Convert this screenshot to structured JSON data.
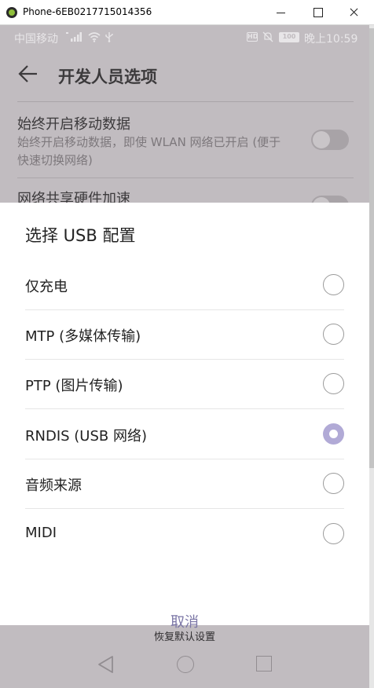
{
  "window": {
    "title": "Phone-6EB0217715014356"
  },
  "statusbar": {
    "carrier": "中国移动",
    "hd_badge": "HD",
    "battery": "100",
    "time": "晚上10:59"
  },
  "appbar": {
    "title": "开发人员选项"
  },
  "settings": [
    {
      "title": "始终开启移动数据",
      "subtitle": "始终开启移动数据，即使 WLAN 网络已开启 (便于快速切换网络)",
      "enabled": false
    },
    {
      "title": "网络共享硬件加速",
      "enabled": false
    }
  ],
  "dialog": {
    "title": "选择 USB 配置",
    "options": [
      {
        "label": "仅充电",
        "selected": false
      },
      {
        "label": "MTP (多媒体传输)",
        "selected": false
      },
      {
        "label": "PTP (图片传输)",
        "selected": false
      },
      {
        "label": "RNDIS (USB 网络)",
        "selected": true
      },
      {
        "label": "音频来源",
        "selected": false
      },
      {
        "label": "MIDI",
        "selected": false
      }
    ],
    "cancel_label": "取消"
  },
  "footer": {
    "restore_label": "恢复默认设置"
  },
  "colors": {
    "accent": "#b1aad6",
    "cancel_text": "#7b76a6",
    "scrim": "#c1bcc0"
  }
}
